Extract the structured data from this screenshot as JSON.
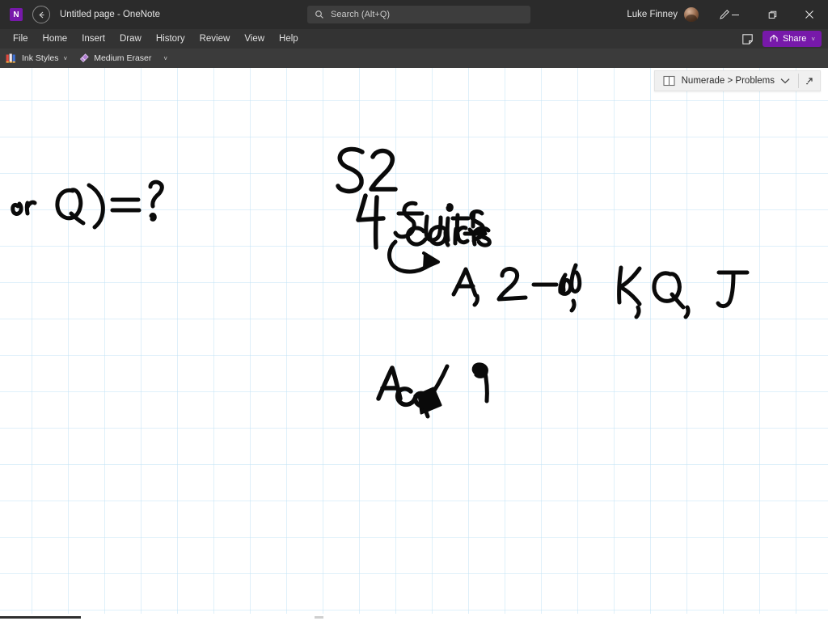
{
  "window": {
    "app_logo_letter": "N",
    "title": "Untitled page  -  OneNote",
    "back_icon": "back-arrow-icon",
    "minimize_label": "—",
    "maximize_label": "❐",
    "close_label": "✕"
  },
  "search": {
    "placeholder": "Search (Alt+Q)",
    "icon": "search-icon"
  },
  "account": {
    "user_name": "Luke Finney",
    "avatar_icon": "user-avatar",
    "pen_icon": "pen-icon"
  },
  "menu": {
    "items": [
      {
        "label": "File"
      },
      {
        "label": "Home"
      },
      {
        "label": "Insert"
      },
      {
        "label": "Draw"
      },
      {
        "label": "History"
      },
      {
        "label": "Review"
      },
      {
        "label": "View"
      },
      {
        "label": "Help"
      }
    ],
    "note_icon": "sticky-note-icon",
    "share_label": "Share",
    "share_icon": "share-icon",
    "share_caret": "˅",
    "share_color": "#7719aa"
  },
  "ribbon": {
    "ink_styles_label": "Ink Styles",
    "ink_styles_icon": "ink-pens-icon",
    "ink_styles_caret": "˅",
    "eraser_label": "Medium Eraser",
    "eraser_icon": "eraser-icon",
    "overflow_caret": "˅"
  },
  "breadcrumb": {
    "notebook_icon": "notebook-icon",
    "text": "Numerade > Problems",
    "chevron_icon": "chevron-down-icon",
    "expand_icon": "expand-diagonal-icon"
  },
  "canvas": {
    "background": "#ffffff",
    "grid_color": "#bfe2f5",
    "grid_spacing_px": 45,
    "ink_color": "#0a0a0a",
    "ink_notes": [
      {
        "id": "left-fragment",
        "text": "or Q) = ?"
      },
      {
        "id": "cards-count",
        "text": "52 cards"
      },
      {
        "id": "suits-count",
        "text": "4 suits"
      },
      {
        "id": "arrow-to-ranks",
        "text": "→"
      },
      {
        "id": "ranks-list",
        "text": "A, 2-10, K, Q, J"
      },
      {
        "id": "arrow-down-left",
        "text": "↙"
      },
      {
        "id": "ace-label",
        "text": "Ace"
      },
      {
        "id": "blob-mark",
        "text": "•"
      }
    ]
  },
  "scrollbar": {
    "orientation": "horizontal",
    "thumb_color": "#2f2f2f"
  }
}
